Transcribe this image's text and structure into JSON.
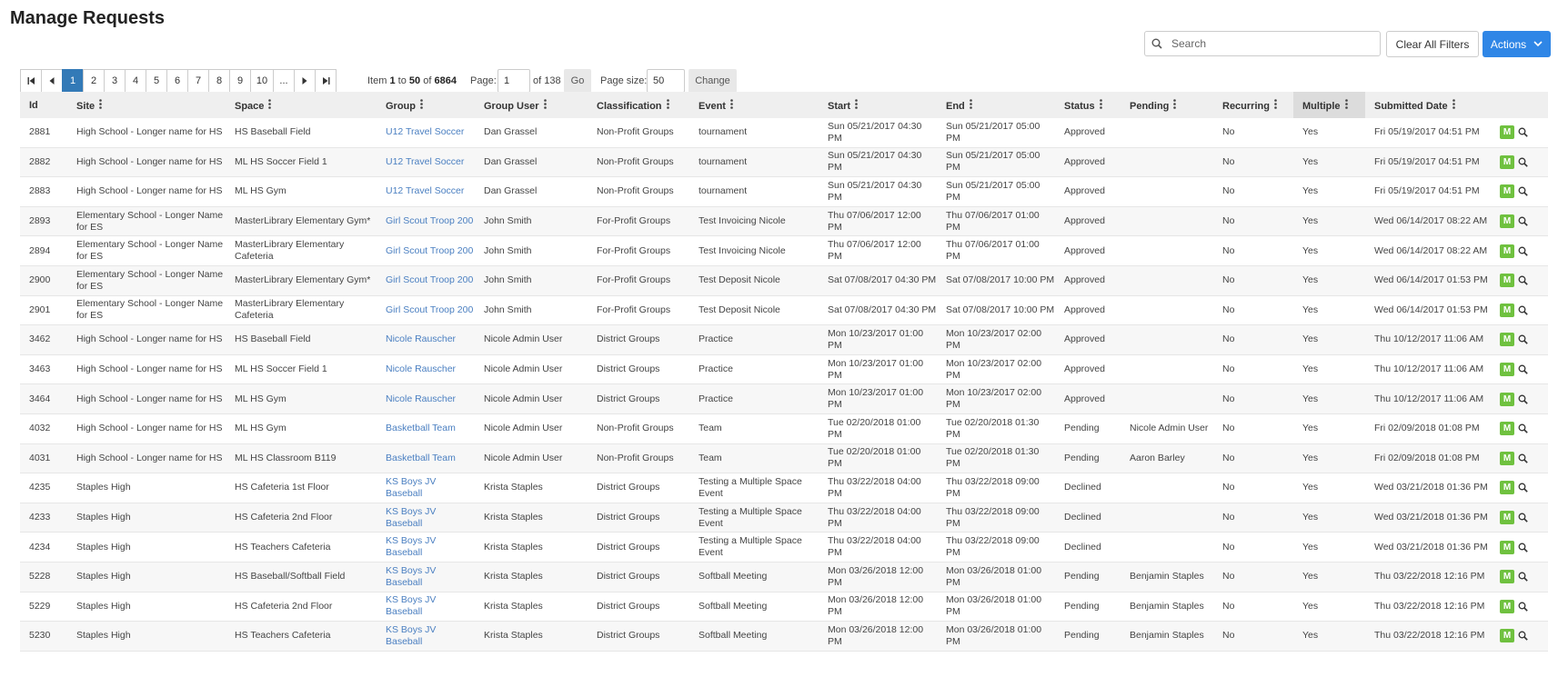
{
  "page_title": "Manage Requests",
  "search": {
    "placeholder": "Search",
    "value": ""
  },
  "buttons": {
    "clear_filters": "Clear All Filters",
    "actions": "Actions"
  },
  "pagination": {
    "pages": [
      "1",
      "2",
      "3",
      "4",
      "5",
      "6",
      "7",
      "8",
      "9",
      "10",
      "..."
    ],
    "current_page": "1",
    "item_label": "Item",
    "item_start": "1",
    "to_label": "to",
    "item_end": "50",
    "of_label": "of",
    "total_items": "6864",
    "page_label": "Page:",
    "page_input": "1",
    "of_pages": "of 138",
    "go": "Go",
    "page_size_label": "Page size:",
    "page_size": "50",
    "change": "Change"
  },
  "columns": [
    "Id",
    "Site",
    "Space",
    "Group",
    "Group User",
    "Classification",
    "Event",
    "Start",
    "End",
    "Status",
    "Pending",
    "Recurring",
    "Multiple",
    "Submitted Date"
  ],
  "sorted_column": "Multiple",
  "row_action_label": "M",
  "rows": [
    {
      "id": "2881",
      "site": "High School - Longer name for HS",
      "space": "HS Baseball Field",
      "group": "U12 Travel Soccer",
      "group_user": "Dan Grassel",
      "classification": "Non-Profit Groups",
      "event": "tournament",
      "start": "Sun 05/21/2017 04:30 PM",
      "end": "Sun 05/21/2017 05:00 PM",
      "status": "Approved",
      "pending": "",
      "recurring": "No",
      "multiple": "Yes",
      "submitted": "Fri 05/19/2017 04:51 PM"
    },
    {
      "id": "2882",
      "site": "High School - Longer name for HS",
      "space": "ML HS Soccer Field 1",
      "group": "U12 Travel Soccer",
      "group_user": "Dan Grassel",
      "classification": "Non-Profit Groups",
      "event": "tournament",
      "start": "Sun 05/21/2017 04:30 PM",
      "end": "Sun 05/21/2017 05:00 PM",
      "status": "Approved",
      "pending": "",
      "recurring": "No",
      "multiple": "Yes",
      "submitted": "Fri 05/19/2017 04:51 PM"
    },
    {
      "id": "2883",
      "site": "High School - Longer name for HS",
      "space": "ML HS Gym",
      "group": "U12 Travel Soccer",
      "group_user": "Dan Grassel",
      "classification": "Non-Profit Groups",
      "event": "tournament",
      "start": "Sun 05/21/2017 04:30 PM",
      "end": "Sun 05/21/2017 05:00 PM",
      "status": "Approved",
      "pending": "",
      "recurring": "No",
      "multiple": "Yes",
      "submitted": "Fri 05/19/2017 04:51 PM"
    },
    {
      "id": "2893",
      "site": "Elementary School - Longer Name for ES",
      "space": "MasterLibrary Elementary Gym*",
      "group": "Girl Scout Troop 200",
      "group_user": "John Smith",
      "classification": "For-Profit Groups",
      "event": "Test Invoicing Nicole",
      "start": "Thu 07/06/2017 12:00 PM",
      "end": "Thu 07/06/2017 01:00 PM",
      "status": "Approved",
      "pending": "",
      "recurring": "No",
      "multiple": "Yes",
      "submitted": "Wed 06/14/2017 08:22 AM"
    },
    {
      "id": "2894",
      "site": "Elementary School - Longer Name for ES",
      "space": "MasterLibrary Elementary Cafeteria",
      "group": "Girl Scout Troop 200",
      "group_user": "John Smith",
      "classification": "For-Profit Groups",
      "event": "Test Invoicing Nicole",
      "start": "Thu 07/06/2017 12:00 PM",
      "end": "Thu 07/06/2017 01:00 PM",
      "status": "Approved",
      "pending": "",
      "recurring": "No",
      "multiple": "Yes",
      "submitted": "Wed 06/14/2017 08:22 AM"
    },
    {
      "id": "2900",
      "site": "Elementary School - Longer Name for ES",
      "space": "MasterLibrary Elementary Gym*",
      "group": "Girl Scout Troop 200",
      "group_user": "John Smith",
      "classification": "For-Profit Groups",
      "event": "Test Deposit Nicole",
      "start": "Sat 07/08/2017 04:30 PM",
      "end": "Sat 07/08/2017 10:00 PM",
      "status": "Approved",
      "pending": "",
      "recurring": "No",
      "multiple": "Yes",
      "submitted": "Wed 06/14/2017 01:53 PM"
    },
    {
      "id": "2901",
      "site": "Elementary School - Longer Name for ES",
      "space": "MasterLibrary Elementary Cafeteria",
      "group": "Girl Scout Troop 200",
      "group_user": "John Smith",
      "classification": "For-Profit Groups",
      "event": "Test Deposit Nicole",
      "start": "Sat 07/08/2017 04:30 PM",
      "end": "Sat 07/08/2017 10:00 PM",
      "status": "Approved",
      "pending": "",
      "recurring": "No",
      "multiple": "Yes",
      "submitted": "Wed 06/14/2017 01:53 PM"
    },
    {
      "id": "3462",
      "site": "High School - Longer name for HS",
      "space": "HS Baseball Field",
      "group": "Nicole Rauscher",
      "group_user": "Nicole Admin User",
      "classification": "District Groups",
      "event": "Practice",
      "start": "Mon 10/23/2017 01:00 PM",
      "end": "Mon 10/23/2017 02:00 PM",
      "status": "Approved",
      "pending": "",
      "recurring": "No",
      "multiple": "Yes",
      "submitted": "Thu 10/12/2017 11:06 AM"
    },
    {
      "id": "3463",
      "site": "High School - Longer name for HS",
      "space": "ML HS Soccer Field 1",
      "group": "Nicole Rauscher",
      "group_user": "Nicole Admin User",
      "classification": "District Groups",
      "event": "Practice",
      "start": "Mon 10/23/2017 01:00 PM",
      "end": "Mon 10/23/2017 02:00 PM",
      "status": "Approved",
      "pending": "",
      "recurring": "No",
      "multiple": "Yes",
      "submitted": "Thu 10/12/2017 11:06 AM"
    },
    {
      "id": "3464",
      "site": "High School - Longer name for HS",
      "space": "ML HS Gym",
      "group": "Nicole Rauscher",
      "group_user": "Nicole Admin User",
      "classification": "District Groups",
      "event": "Practice",
      "start": "Mon 10/23/2017 01:00 PM",
      "end": "Mon 10/23/2017 02:00 PM",
      "status": "Approved",
      "pending": "",
      "recurring": "No",
      "multiple": "Yes",
      "submitted": "Thu 10/12/2017 11:06 AM"
    },
    {
      "id": "4032",
      "site": "High School - Longer name for HS",
      "space": "ML HS Gym",
      "group": "Basketball Team",
      "group_user": "Nicole Admin User",
      "classification": "Non-Profit Groups",
      "event": "Team",
      "start": "Tue 02/20/2018 01:00 PM",
      "end": "Tue 02/20/2018 01:30 PM",
      "status": "Pending",
      "pending": "Nicole Admin User",
      "recurring": "No",
      "multiple": "Yes",
      "submitted": "Fri 02/09/2018 01:08 PM"
    },
    {
      "id": "4031",
      "site": "High School - Longer name for HS",
      "space": "ML HS Classroom B119",
      "group": "Basketball Team",
      "group_user": "Nicole Admin User",
      "classification": "Non-Profit Groups",
      "event": "Team",
      "start": "Tue 02/20/2018 01:00 PM",
      "end": "Tue 02/20/2018 01:30 PM",
      "status": "Pending",
      "pending": "Aaron Barley",
      "recurring": "No",
      "multiple": "Yes",
      "submitted": "Fri 02/09/2018 01:08 PM"
    },
    {
      "id": "4235",
      "site": "Staples High",
      "space": "HS Cafeteria 1st Floor",
      "group": "KS Boys JV Baseball",
      "group_user": "Krista Staples",
      "classification": "District Groups",
      "event": "Testing a Multiple Space Event",
      "start": "Thu 03/22/2018 04:00 PM",
      "end": "Thu 03/22/2018 09:00 PM",
      "status": "Declined",
      "pending": "",
      "recurring": "No",
      "multiple": "Yes",
      "submitted": "Wed 03/21/2018 01:36 PM"
    },
    {
      "id": "4233",
      "site": "Staples High",
      "space": "HS Cafeteria 2nd Floor",
      "group": "KS Boys JV Baseball",
      "group_user": "Krista Staples",
      "classification": "District Groups",
      "event": "Testing a Multiple Space Event",
      "start": "Thu 03/22/2018 04:00 PM",
      "end": "Thu 03/22/2018 09:00 PM",
      "status": "Declined",
      "pending": "",
      "recurring": "No",
      "multiple": "Yes",
      "submitted": "Wed 03/21/2018 01:36 PM"
    },
    {
      "id": "4234",
      "site": "Staples High",
      "space": "HS Teachers Cafeteria",
      "group": "KS Boys JV Baseball",
      "group_user": "Krista Staples",
      "classification": "District Groups",
      "event": "Testing a Multiple Space Event",
      "start": "Thu 03/22/2018 04:00 PM",
      "end": "Thu 03/22/2018 09:00 PM",
      "status": "Declined",
      "pending": "",
      "recurring": "No",
      "multiple": "Yes",
      "submitted": "Wed 03/21/2018 01:36 PM"
    },
    {
      "id": "5228",
      "site": "Staples High",
      "space": "HS Baseball/Softball Field",
      "group": "KS Boys JV Baseball",
      "group_user": "Krista Staples",
      "classification": "District Groups",
      "event": "Softball Meeting",
      "start": "Mon 03/26/2018 12:00 PM",
      "end": "Mon 03/26/2018 01:00 PM",
      "status": "Pending",
      "pending": "Benjamin Staples",
      "recurring": "No",
      "multiple": "Yes",
      "submitted": "Thu 03/22/2018 12:16 PM"
    },
    {
      "id": "5229",
      "site": "Staples High",
      "space": "HS Cafeteria 2nd Floor",
      "group": "KS Boys JV Baseball",
      "group_user": "Krista Staples",
      "classification": "District Groups",
      "event": "Softball Meeting",
      "start": "Mon 03/26/2018 12:00 PM",
      "end": "Mon 03/26/2018 01:00 PM",
      "status": "Pending",
      "pending": "Benjamin Staples",
      "recurring": "No",
      "multiple": "Yes",
      "submitted": "Thu 03/22/2018 12:16 PM"
    },
    {
      "id": "5230",
      "site": "Staples High",
      "space": "HS Teachers Cafeteria",
      "group": "KS Boys JV Baseball",
      "group_user": "Krista Staples",
      "classification": "District Groups",
      "event": "Softball Meeting",
      "start": "Mon 03/26/2018 12:00 PM",
      "end": "Mon 03/26/2018 01:00 PM",
      "status": "Pending",
      "pending": "Benjamin Staples",
      "recurring": "No",
      "multiple": "Yes",
      "submitted": "Thu 03/22/2018 12:16 PM"
    }
  ],
  "colors": {
    "accent": "#2f86e6",
    "active_page": "#337ab7",
    "link": "#4a7fc1",
    "m_button": "#6fc13f"
  }
}
